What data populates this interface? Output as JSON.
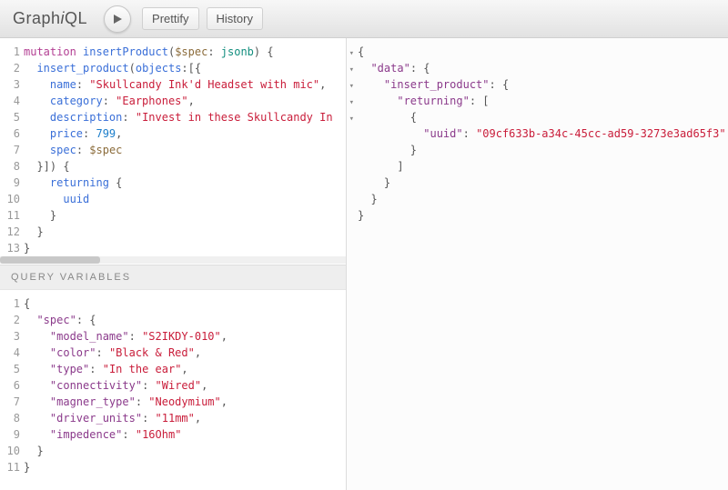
{
  "logo": "GraphiQL",
  "toolbar": {
    "prettify": "Prettify",
    "history": "History"
  },
  "variables_header": "Query Variables",
  "query": {
    "lines": [
      [
        {
          "t": "mutation ",
          "c": "kw"
        },
        {
          "t": "insertProduct",
          "c": "fn"
        },
        {
          "t": "(",
          "c": "punct"
        },
        {
          "t": "$spec",
          "c": "arg"
        },
        {
          "t": ": ",
          "c": "punct"
        },
        {
          "t": "jsonb",
          "c": "type"
        },
        {
          "t": ") {",
          "c": "punct"
        }
      ],
      [
        {
          "t": "  ",
          "c": ""
        },
        {
          "t": "insert_product",
          "c": "prop"
        },
        {
          "t": "(",
          "c": "punct"
        },
        {
          "t": "objects",
          "c": "prop"
        },
        {
          "t": ":[{",
          "c": "punct"
        }
      ],
      [
        {
          "t": "    ",
          "c": ""
        },
        {
          "t": "name",
          "c": "prop"
        },
        {
          "t": ": ",
          "c": "punct"
        },
        {
          "t": "\"Skullcandy Ink'd Headset with mic\"",
          "c": "str"
        },
        {
          "t": ",",
          "c": "punct"
        }
      ],
      [
        {
          "t": "    ",
          "c": ""
        },
        {
          "t": "category",
          "c": "prop"
        },
        {
          "t": ": ",
          "c": "punct"
        },
        {
          "t": "\"Earphones\"",
          "c": "str"
        },
        {
          "t": ",",
          "c": "punct"
        }
      ],
      [
        {
          "t": "    ",
          "c": ""
        },
        {
          "t": "description",
          "c": "prop"
        },
        {
          "t": ": ",
          "c": "punct"
        },
        {
          "t": "\"Invest in these Skullcandy In",
          "c": "str"
        }
      ],
      [
        {
          "t": "    ",
          "c": ""
        },
        {
          "t": "price",
          "c": "prop"
        },
        {
          "t": ": ",
          "c": "punct"
        },
        {
          "t": "799",
          "c": "num"
        },
        {
          "t": ",",
          "c": "punct"
        }
      ],
      [
        {
          "t": "    ",
          "c": ""
        },
        {
          "t": "spec",
          "c": "prop"
        },
        {
          "t": ": ",
          "c": "punct"
        },
        {
          "t": "$spec",
          "c": "arg"
        }
      ],
      [
        {
          "t": "  }]) {",
          "c": "punct"
        }
      ],
      [
        {
          "t": "    ",
          "c": ""
        },
        {
          "t": "returning",
          "c": "prop"
        },
        {
          "t": " {",
          "c": "punct"
        }
      ],
      [
        {
          "t": "      ",
          "c": ""
        },
        {
          "t": "uuid",
          "c": "prop"
        }
      ],
      [
        {
          "t": "    }",
          "c": "punct"
        }
      ],
      [
        {
          "t": "  }",
          "c": "punct"
        }
      ],
      [
        {
          "t": "}",
          "c": "punct"
        }
      ]
    ],
    "folds": [
      1,
      2,
      8,
      9
    ]
  },
  "variables": {
    "lines": [
      [
        {
          "t": "{",
          "c": "punct"
        }
      ],
      [
        {
          "t": "  ",
          "c": ""
        },
        {
          "t": "\"spec\"",
          "c": "jkey"
        },
        {
          "t": ": {",
          "c": "punct"
        }
      ],
      [
        {
          "t": "    ",
          "c": ""
        },
        {
          "t": "\"model_name\"",
          "c": "jkey"
        },
        {
          "t": ": ",
          "c": "punct"
        },
        {
          "t": "\"S2IKDY-010\"",
          "c": "jstr"
        },
        {
          "t": ",",
          "c": "punct"
        }
      ],
      [
        {
          "t": "    ",
          "c": ""
        },
        {
          "t": "\"color\"",
          "c": "jkey"
        },
        {
          "t": ": ",
          "c": "punct"
        },
        {
          "t": "\"Black & Red\"",
          "c": "jstr"
        },
        {
          "t": ",",
          "c": "punct"
        }
      ],
      [
        {
          "t": "    ",
          "c": ""
        },
        {
          "t": "\"type\"",
          "c": "jkey"
        },
        {
          "t": ": ",
          "c": "punct"
        },
        {
          "t": "\"In the ear\"",
          "c": "jstr"
        },
        {
          "t": ",",
          "c": "punct"
        }
      ],
      [
        {
          "t": "    ",
          "c": ""
        },
        {
          "t": "\"connectivity\"",
          "c": "jkey"
        },
        {
          "t": ": ",
          "c": "punct"
        },
        {
          "t": "\"Wired\"",
          "c": "jstr"
        },
        {
          "t": ",",
          "c": "punct"
        }
      ],
      [
        {
          "t": "    ",
          "c": ""
        },
        {
          "t": "\"magner_type\"",
          "c": "jkey"
        },
        {
          "t": ": ",
          "c": "punct"
        },
        {
          "t": "\"Neodymium\"",
          "c": "jstr"
        },
        {
          "t": ",",
          "c": "punct"
        }
      ],
      [
        {
          "t": "    ",
          "c": ""
        },
        {
          "t": "\"driver_units\"",
          "c": "jkey"
        },
        {
          "t": ": ",
          "c": "punct"
        },
        {
          "t": "\"11mm\"",
          "c": "jstr"
        },
        {
          "t": ",",
          "c": "punct"
        }
      ],
      [
        {
          "t": "    ",
          "c": ""
        },
        {
          "t": "\"impedence\"",
          "c": "jkey"
        },
        {
          "t": ": ",
          "c": "punct"
        },
        {
          "t": "\"16Ohm\"",
          "c": "jstr"
        }
      ],
      [
        {
          "t": "  }",
          "c": "punct"
        }
      ],
      [
        {
          "t": "}",
          "c": "punct"
        }
      ]
    ],
    "folds": [
      1,
      2
    ]
  },
  "result": {
    "lines": [
      [
        {
          "t": "{",
          "c": "punct"
        }
      ],
      [
        {
          "t": "  ",
          "c": ""
        },
        {
          "t": "\"data\"",
          "c": "jkey"
        },
        {
          "t": ": {",
          "c": "punct"
        }
      ],
      [
        {
          "t": "    ",
          "c": ""
        },
        {
          "t": "\"insert_product\"",
          "c": "jkey"
        },
        {
          "t": ": {",
          "c": "punct"
        }
      ],
      [
        {
          "t": "      ",
          "c": ""
        },
        {
          "t": "\"returning\"",
          "c": "jkey"
        },
        {
          "t": ": [",
          "c": "punct"
        }
      ],
      [
        {
          "t": "        {",
          "c": "punct"
        }
      ],
      [
        {
          "t": "          ",
          "c": ""
        },
        {
          "t": "\"uuid\"",
          "c": "jkey"
        },
        {
          "t": ": ",
          "c": "punct"
        },
        {
          "t": "\"09cf633b-a34c-45cc-ad59-3273e3ad65f3\"",
          "c": "jstr"
        }
      ],
      [
        {
          "t": "        }",
          "c": "punct"
        }
      ],
      [
        {
          "t": "      ]",
          "c": "punct"
        }
      ],
      [
        {
          "t": "    }",
          "c": "punct"
        }
      ],
      [
        {
          "t": "  }",
          "c": "punct"
        }
      ],
      [
        {
          "t": "}",
          "c": "punct"
        }
      ]
    ],
    "folds": [
      1,
      2,
      3,
      4,
      5
    ]
  }
}
